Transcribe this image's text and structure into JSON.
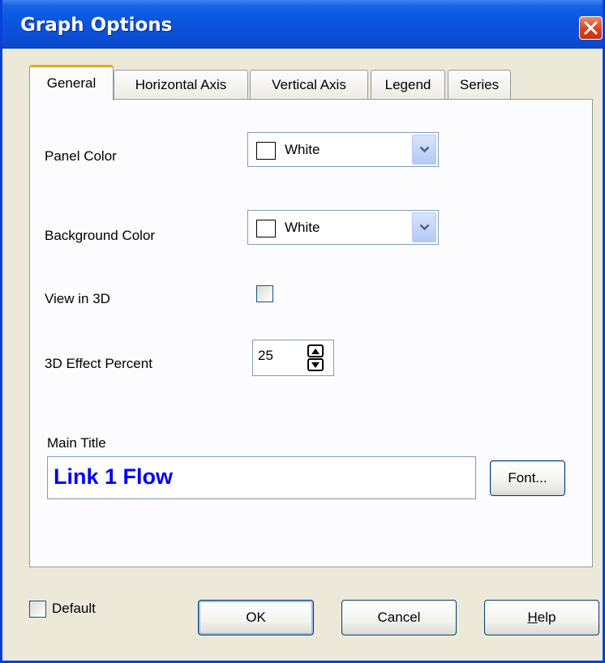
{
  "window": {
    "title": "Graph Options"
  },
  "tabs": [
    {
      "label": "General",
      "active": true
    },
    {
      "label": "Horizontal Axis",
      "active": false
    },
    {
      "label": "Vertical Axis",
      "active": false
    },
    {
      "label": "Legend",
      "active": false
    },
    {
      "label": "Series",
      "active": false
    }
  ],
  "general": {
    "panel_color": {
      "label": "Panel Color",
      "value": "White",
      "swatch": "#ffffff"
    },
    "background_color": {
      "label": "Background Color",
      "value": "White",
      "swatch": "#ffffff"
    },
    "view_3d": {
      "label": "View in 3D",
      "checked": false
    },
    "effect_percent": {
      "label": "3D Effect Percent",
      "value": "25"
    },
    "main_title": {
      "label": "Main Title",
      "value": "Link 1 Flow",
      "color": "#0000ff"
    },
    "font_button": "Font..."
  },
  "footer": {
    "default_checkbox": {
      "label": "Default",
      "checked": false
    },
    "ok": "OK",
    "cancel": "Cancel",
    "help": {
      "mnemonic": "H",
      "rest": "elp"
    }
  },
  "colors": {
    "titlebar": "#0a56e0",
    "dialog_face": "#ece9d8",
    "active_tab_accent": "#e5a627",
    "close_button": "#d8431f"
  },
  "icons": {
    "close": "close-icon",
    "dropdown": "chevron-down-icon",
    "spin_up": "arrow-up-icon",
    "spin_down": "arrow-down-icon"
  }
}
